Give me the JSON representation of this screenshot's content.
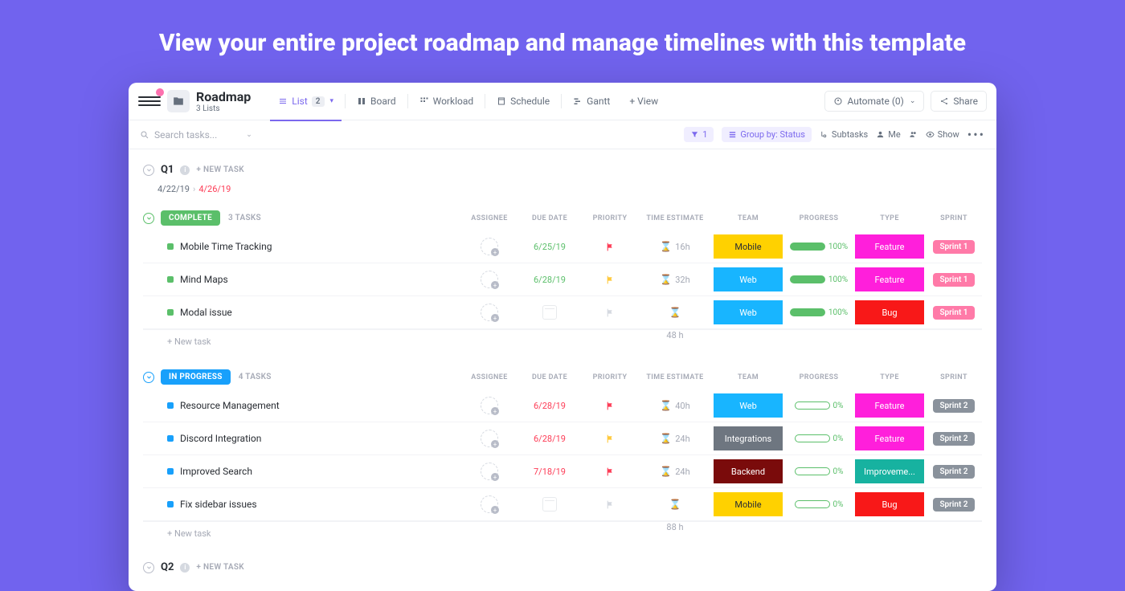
{
  "hero": "View your entire project roadmap and manage timelines with this template",
  "header": {
    "title": "Roadmap",
    "subtitle": "3 Lists",
    "views": {
      "list": "List",
      "list_count": "2",
      "board": "Board",
      "workload": "Workload",
      "schedule": "Schedule",
      "gantt": "Gantt",
      "add_view": "+ View"
    },
    "automate": "Automate (0)",
    "share": "Share"
  },
  "toolbar": {
    "search_placeholder": "Search tasks...",
    "filter_count": "1",
    "group_by": "Group by: Status",
    "subtasks": "Subtasks",
    "me": "Me",
    "show": "Show"
  },
  "columns": {
    "assignee": "ASSIGNEE",
    "due": "DUE DATE",
    "priority": "PRIORITY",
    "est": "TIME ESTIMATE",
    "team": "TEAM",
    "progress": "PROGRESS",
    "type": "TYPE",
    "sprint": "SPRINT"
  },
  "colors": {
    "complete": "#5bbf6a",
    "inprogress": "#18a0fb",
    "team_mobile": "#ffd100",
    "team_web": "#18b5ff",
    "team_integrations": "#6e7680",
    "team_backend": "#7a0b0b",
    "type_feature": "#ff1fdb",
    "type_bug": "#f81818",
    "type_improvement": "#17b2a0",
    "sprint1": "#ff7aa8",
    "sprint2": "#8a929c"
  },
  "quarters": [
    {
      "name": "Q1",
      "dates": {
        "start": "4/22/19",
        "end": "4/26/19"
      },
      "new_task": "+ NEW TASK",
      "groups": [
        {
          "status": "COMPLETE",
          "status_color": "complete",
          "count": "3 TASKS",
          "sum_est": "48 h",
          "tasks": [
            {
              "name": "Mobile Time Tracking",
              "due": "6/25/19",
              "due_overdue": false,
              "priority": "red",
              "est": "16h",
              "team": "Mobile",
              "team_color": "team_mobile",
              "team_text": "#2a2e34",
              "progress": 100,
              "type": "Feature",
              "type_color": "type_feature",
              "sprint": "Sprint 1",
              "sprint_color": "sprint1"
            },
            {
              "name": "Mind Maps",
              "due": "6/28/19",
              "due_overdue": false,
              "priority": "yellow",
              "est": "32h",
              "team": "Web",
              "team_color": "team_web",
              "team_text": "#fff",
              "progress": 100,
              "type": "Feature",
              "type_color": "type_feature",
              "sprint": "Sprint 1",
              "sprint_color": "sprint1"
            },
            {
              "name": "Modal issue",
              "due": "",
              "due_overdue": false,
              "priority": "grey",
              "est": "",
              "team": "Web",
              "team_color": "team_web",
              "team_text": "#fff",
              "progress": 100,
              "type": "Bug",
              "type_color": "type_bug",
              "sprint": "Sprint 1",
              "sprint_color": "sprint1"
            }
          ]
        },
        {
          "status": "IN PROGRESS",
          "status_color": "inprogress",
          "count": "4 TASKS",
          "sum_est": "88 h",
          "tasks": [
            {
              "name": "Resource Management",
              "due": "6/28/19",
              "due_overdue": true,
              "priority": "red",
              "est": "40h",
              "team": "Web",
              "team_color": "team_web",
              "team_text": "#fff",
              "progress": 0,
              "type": "Feature",
              "type_color": "type_feature",
              "sprint": "Sprint 2",
              "sprint_color": "sprint2"
            },
            {
              "name": "Discord Integration",
              "due": "6/28/19",
              "due_overdue": true,
              "priority": "yellow",
              "est": "24h",
              "team": "Integrations",
              "team_color": "team_integrations",
              "team_text": "#fff",
              "progress": 0,
              "type": "Feature",
              "type_color": "type_feature",
              "sprint": "Sprint 2",
              "sprint_color": "sprint2"
            },
            {
              "name": "Improved Search",
              "due": "7/18/19",
              "due_overdue": true,
              "priority": "red",
              "est": "24h",
              "team": "Backend",
              "team_color": "team_backend",
              "team_text": "#fff",
              "progress": 0,
              "type": "Improveme...",
              "type_color": "type_improvement",
              "sprint": "Sprint 2",
              "sprint_color": "sprint2"
            },
            {
              "name": "Fix sidebar issues",
              "due": "",
              "due_overdue": false,
              "priority": "grey",
              "est": "",
              "team": "Mobile",
              "team_color": "team_mobile",
              "team_text": "#2a2e34",
              "progress": 0,
              "type": "Bug",
              "type_color": "type_bug",
              "sprint": "Sprint 2",
              "sprint_color": "sprint2"
            }
          ]
        }
      ]
    },
    {
      "name": "Q2",
      "new_task": "+ NEW TASK"
    }
  ],
  "new_task_label": "+ New task"
}
